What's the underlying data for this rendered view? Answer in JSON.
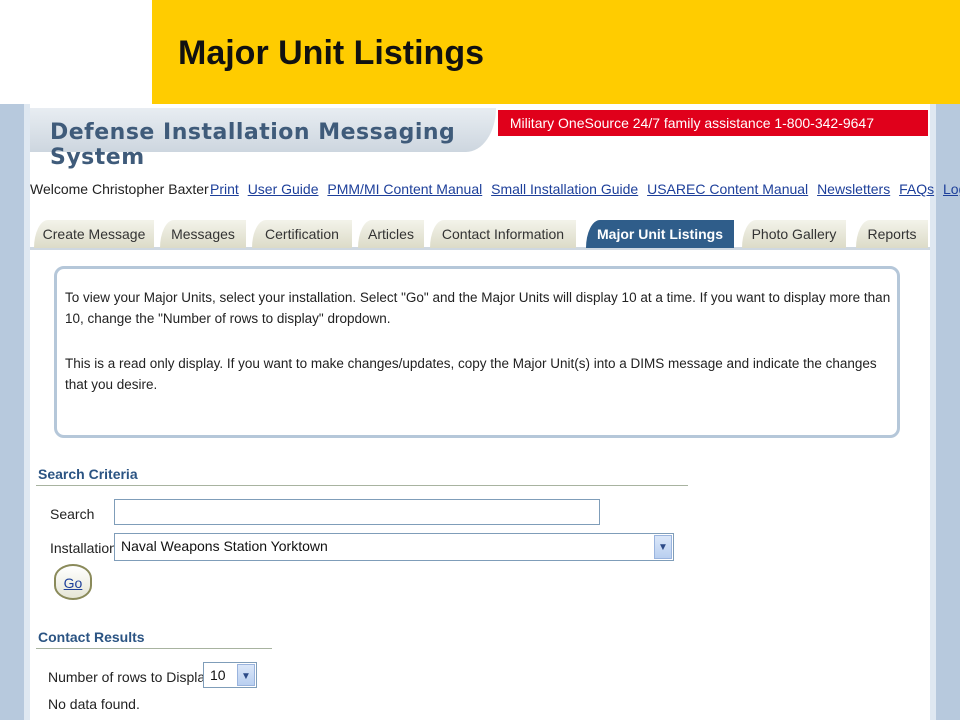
{
  "slide": {
    "title": "Major Unit Listings"
  },
  "banner": {
    "app_title": "Defense Installation Messaging System",
    "assistance": "Military OneSource 24/7 family assistance 1-800-342-9647"
  },
  "header": {
    "welcome": "Welcome Christopher Baxter",
    "links": [
      "Print",
      "User Guide",
      "PMM/MI Content Manual",
      "Small Installation Guide",
      "USAREC Content Manual",
      "Newsletters",
      "FAQs",
      "Logout"
    ]
  },
  "tabs": [
    {
      "label": "Create Message"
    },
    {
      "label": "Messages"
    },
    {
      "label": "Certification"
    },
    {
      "label": "Articles"
    },
    {
      "label": "Contact Information"
    },
    {
      "label": "Major Unit Listings",
      "active": true
    },
    {
      "label": "Photo Gallery"
    },
    {
      "label": "Reports"
    }
  ],
  "info": {
    "paragraph1": "To view your Major Units, select your installation. Select \"Go\" and the Major Units will display 10 at a time. If you want to display more than 10, change the \"Number of rows to display\" dropdown.",
    "paragraph2": "This is a read only display. If you want to make changes/updates, copy the Major Unit(s) into a DIMS message and indicate the changes that you desire."
  },
  "search_criteria": {
    "heading": "Search Criteria",
    "search_label": "Search",
    "search_value": "",
    "installation_label": "Installation",
    "installation_value": "Naval Weapons Station Yorktown",
    "go_label": "Go"
  },
  "results": {
    "heading": "Contact Results",
    "rows_label": "Number of rows to Display",
    "rows_value": "10",
    "message": "No data found."
  }
}
